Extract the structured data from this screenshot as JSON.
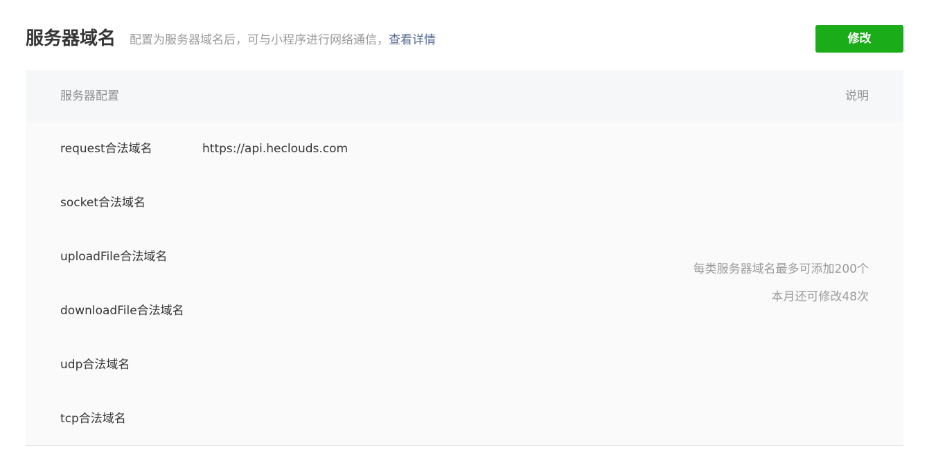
{
  "header": {
    "title": "服务器域名",
    "description": "配置为服务器域名后，可与小程序进行网络通信，",
    "details_link": "查看详情",
    "edit_button": "修改"
  },
  "table": {
    "column_config": "服务器配置",
    "column_desc": "说明",
    "rows": [
      {
        "label": "request合法域名",
        "value": "https://api.heclouds.com"
      },
      {
        "label": "socket合法域名",
        "value": ""
      },
      {
        "label": "uploadFile合法域名",
        "value": ""
      },
      {
        "label": "downloadFile合法域名",
        "value": ""
      },
      {
        "label": "udp合法域名",
        "value": ""
      },
      {
        "label": "tcp合法域名",
        "value": ""
      }
    ],
    "notes": [
      "每类服务器域名最多可添加200个",
      "本月还可修改48次"
    ]
  },
  "colors": {
    "primary_green": "#1aad19",
    "link_blue": "#576b95",
    "muted_text": "#9a9a9a"
  }
}
